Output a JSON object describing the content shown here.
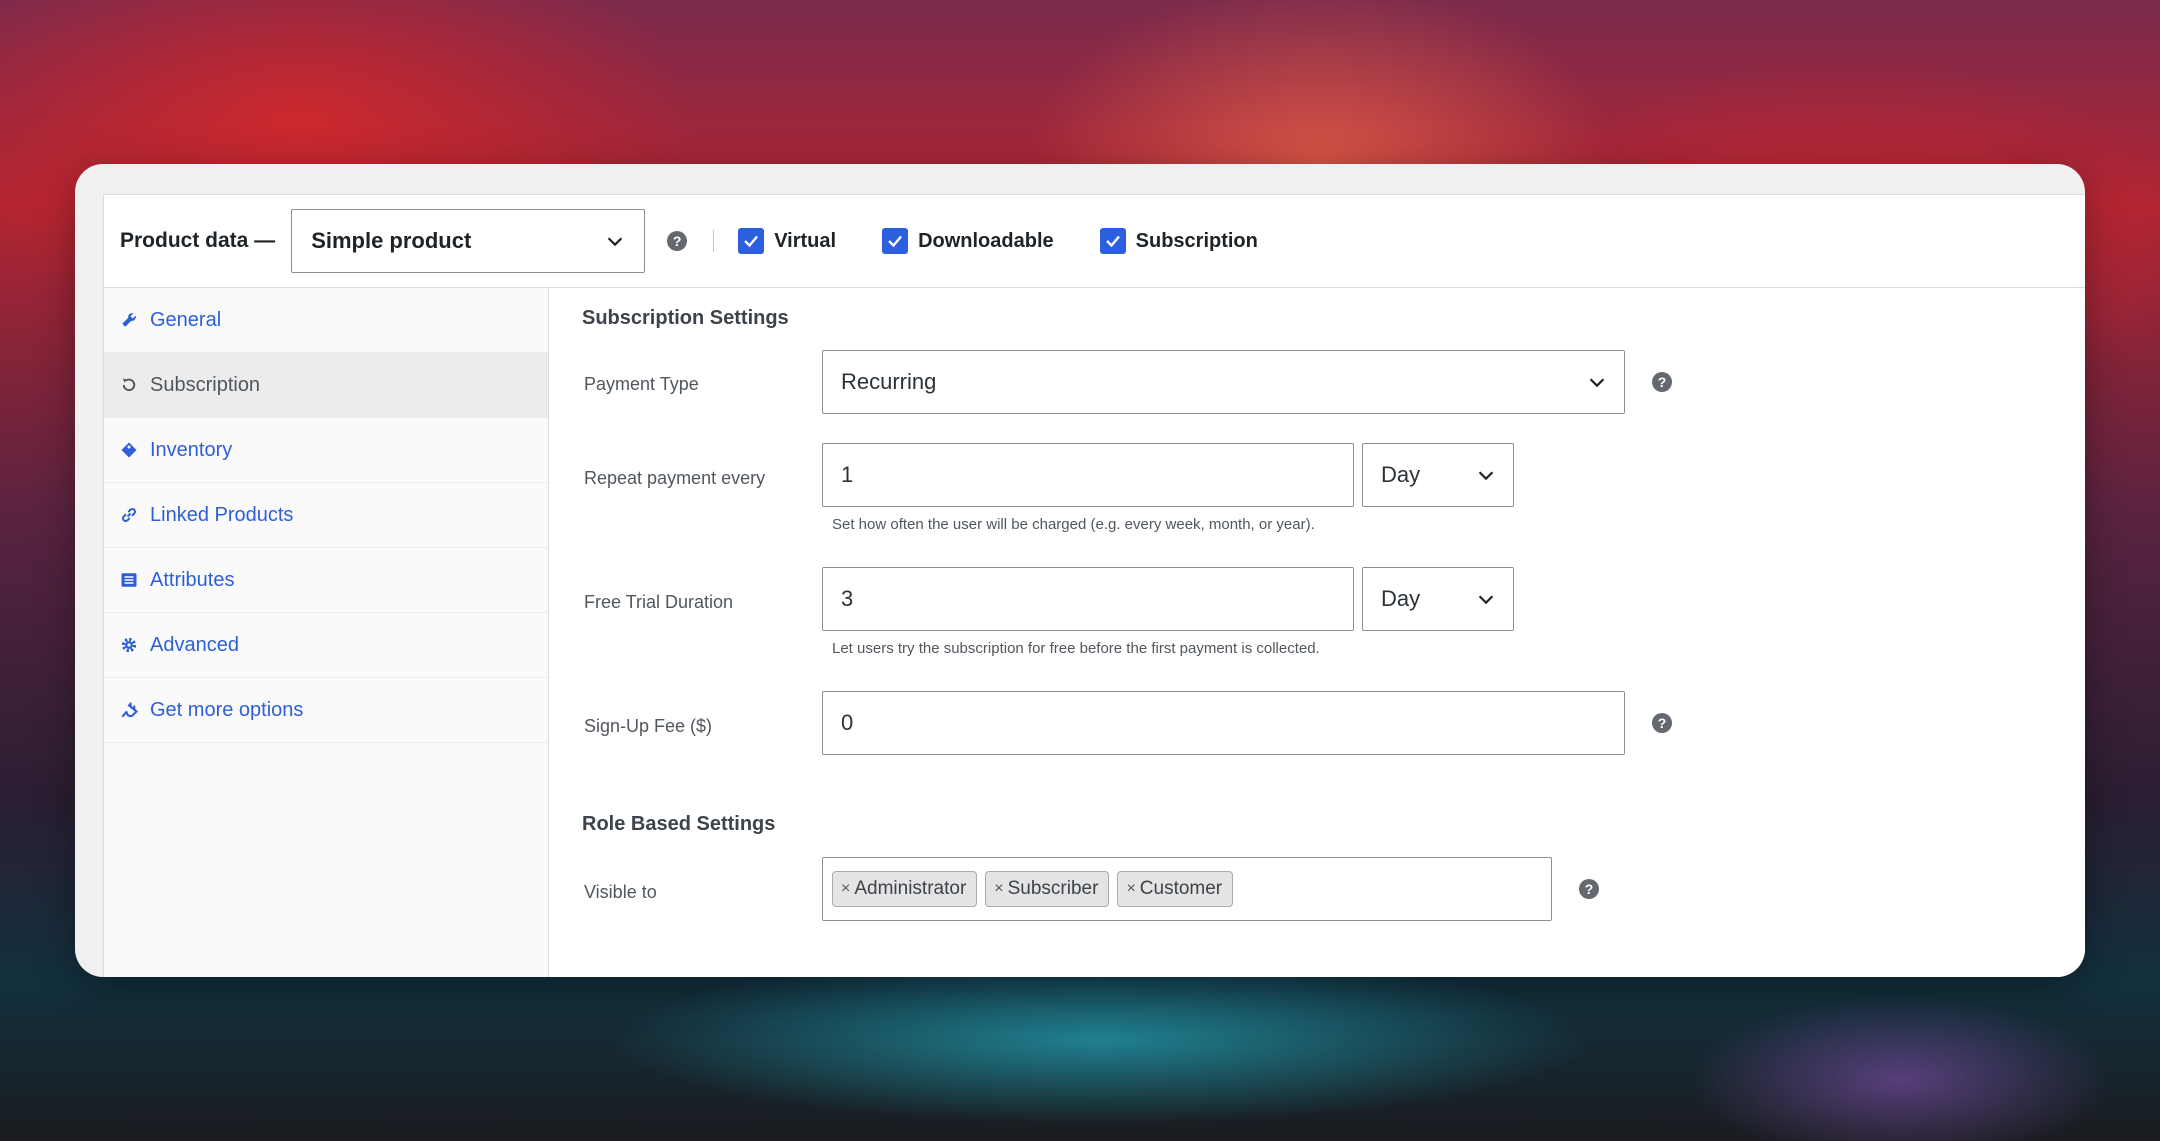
{
  "header": {
    "title": "Product data —",
    "product_type": "Simple product",
    "checkboxes": [
      {
        "label": "Virtual",
        "checked": true
      },
      {
        "label": "Downloadable",
        "checked": true
      },
      {
        "label": "Subscription",
        "checked": true
      }
    ]
  },
  "sidebar": {
    "items": [
      {
        "label": "General",
        "icon": "wrench-icon",
        "active": false
      },
      {
        "label": "Subscription",
        "icon": "refresh-icon",
        "active": true
      },
      {
        "label": "Inventory",
        "icon": "tag-icon",
        "active": false
      },
      {
        "label": "Linked Products",
        "icon": "link-icon",
        "active": false
      },
      {
        "label": "Attributes",
        "icon": "list-icon",
        "active": false
      },
      {
        "label": "Advanced",
        "icon": "gear-icon",
        "active": false
      },
      {
        "label": "Get more options",
        "icon": "plugin-icon",
        "active": false
      }
    ]
  },
  "subscription": {
    "section_title": "Subscription Settings",
    "payment_type": {
      "label": "Payment Type",
      "value": "Recurring"
    },
    "repeat": {
      "label": "Repeat payment every",
      "value": "1",
      "unit": "Day",
      "description": "Set how often the user will be charged (e.g. every week, month, or year)."
    },
    "trial": {
      "label": "Free Trial Duration",
      "value": "3",
      "unit": "Day",
      "description": "Let users try the subscription for free before the first payment is collected."
    },
    "signup_fee": {
      "label": "Sign-Up Fee ($)",
      "value": "0"
    }
  },
  "roles": {
    "section_title": "Role Based Settings",
    "visible_to_label": "Visible to",
    "tags": [
      "Administrator",
      "Subscriber",
      "Customer"
    ],
    "tag_remove": "×"
  },
  "help_glyph": "?",
  "colors": {
    "accent": "#2c5fe0",
    "link": "#2e5fd6"
  }
}
